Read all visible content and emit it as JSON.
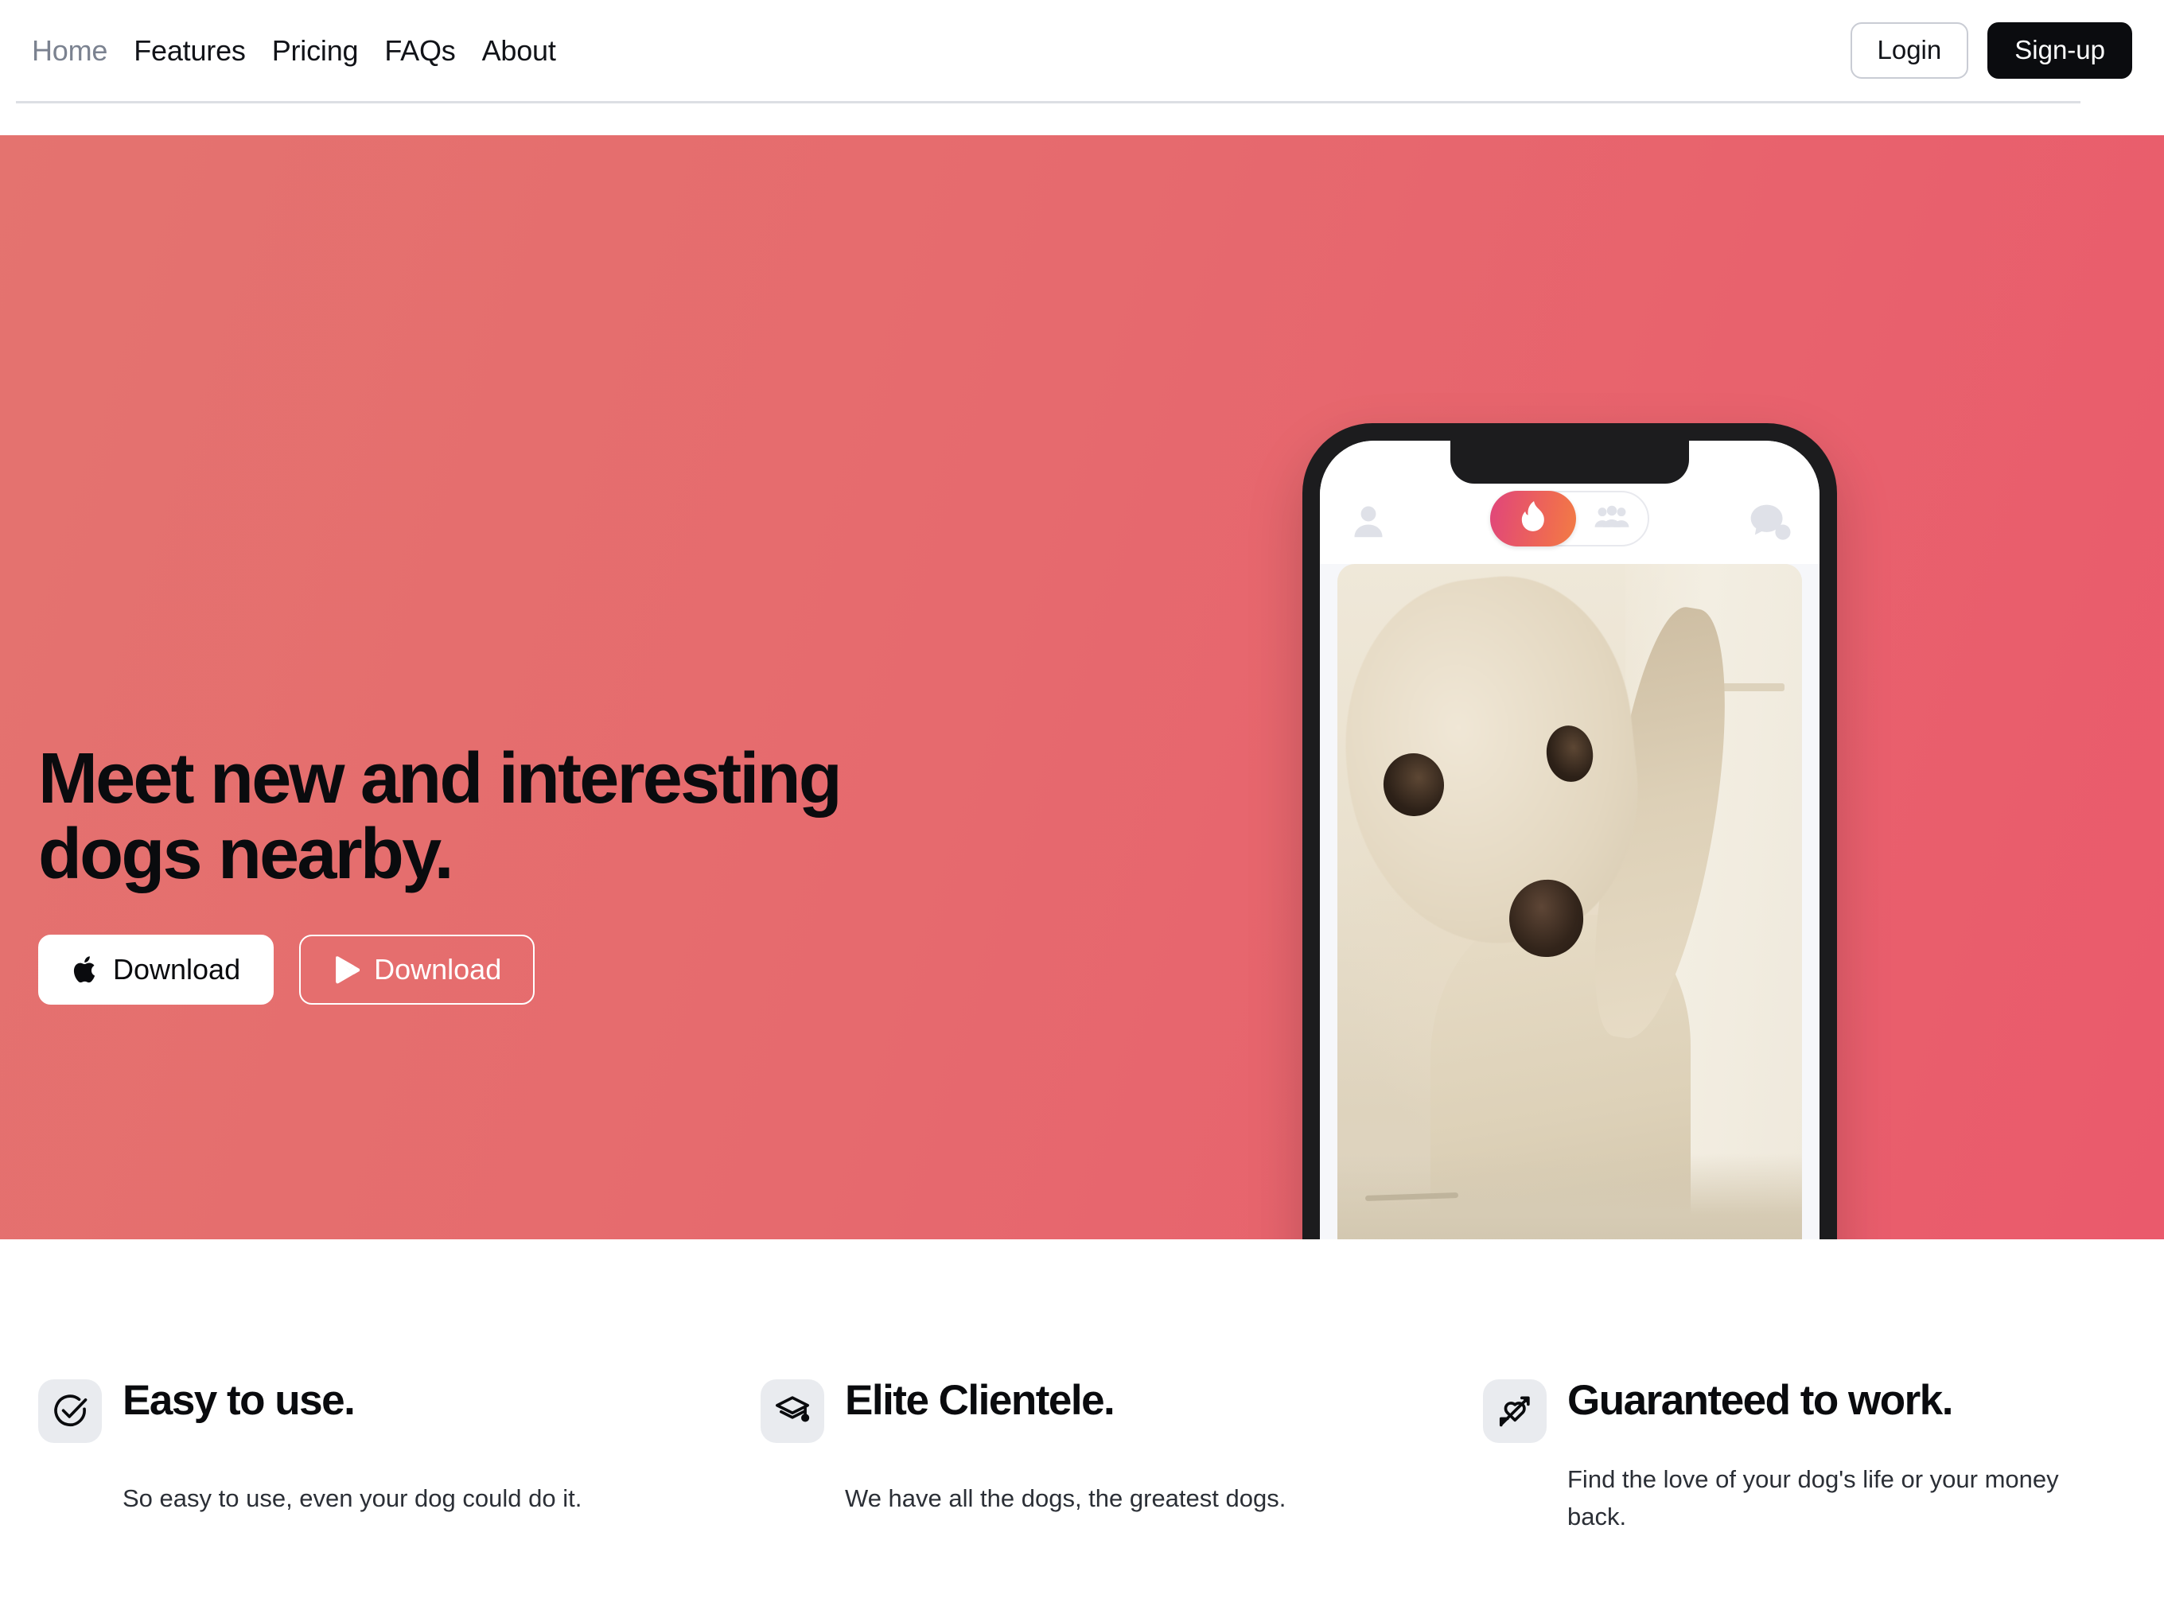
{
  "header": {
    "nav": [
      {
        "label": "Home",
        "state": "muted",
        "icon": ""
      },
      {
        "label": "Features",
        "state": "default",
        "icon": ""
      },
      {
        "label": "Pricing",
        "state": "default",
        "icon": ""
      },
      {
        "label": "FAQs",
        "state": "default",
        "icon": ""
      },
      {
        "label": "About",
        "state": "default",
        "icon": ""
      }
    ],
    "login_label": "Login",
    "signup_label": "Sign-up"
  },
  "hero": {
    "title": "Meet new and interesting dogs nearby.",
    "background_color": "#e6696e",
    "buttons": [
      {
        "label": "Download",
        "icon": "apple-icon",
        "style": "light"
      },
      {
        "label": "Download",
        "icon": "google-play-icon",
        "style": "outline"
      }
    ]
  },
  "phone": {
    "topbar": {
      "profile_icon": "person-icon",
      "chat_icon": "chat-bubble-icon",
      "toggle": {
        "active_icon": "flame-icon",
        "inactive_icon": "people-icon",
        "active_gradient_from": "#e0457b",
        "active_gradient_to": "#f27c45"
      }
    },
    "card": {
      "image_alt": "dog-photo"
    },
    "actions": [
      {
        "icon": "rewind-icon",
        "color": "#f5b945"
      },
      {
        "icon": "close-x-icon",
        "color": "#ed5b61"
      },
      {
        "icon": "lightning-bolt-icon",
        "color": "#7b3fd1"
      },
      {
        "icon": "heart-icon",
        "color": "#6ccb9a"
      },
      {
        "icon": "star-icon",
        "color": "#4a9ee0"
      }
    ]
  },
  "features": [
    {
      "icon": "check-circle-icon",
      "title": "Easy to use.",
      "description": "So easy to use, even your dog could do it."
    },
    {
      "icon": "graduation-cap-icon",
      "title": "Elite Clientele.",
      "description": "We have all the dogs, the greatest dogs."
    },
    {
      "icon": "heart-arrow-icon",
      "title": "Guaranteed to work.",
      "description": "Find the love of your dog's life or your money back."
    }
  ]
}
